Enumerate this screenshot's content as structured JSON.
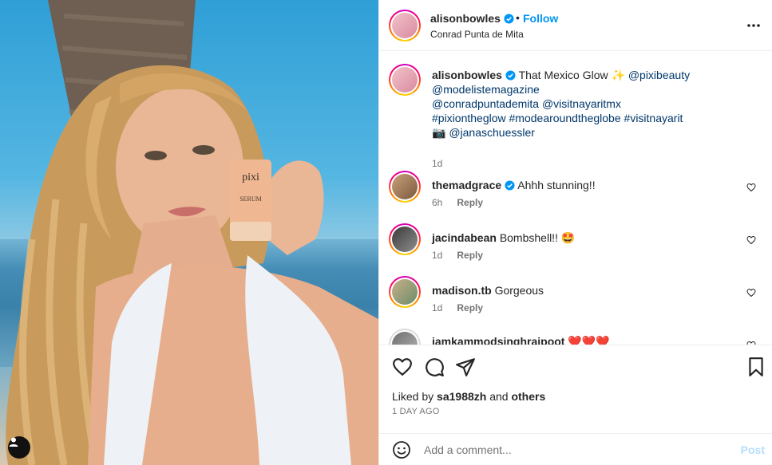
{
  "post": {
    "username": "alisonbowles",
    "follow_label": "Follow",
    "separator": "•",
    "location": "Conrad Punta de Mita",
    "photo": {
      "product_brand": "pixi",
      "product_name": "SERUM"
    }
  },
  "caption": {
    "username": "alisonbowles",
    "text": "That Mexico Glow",
    "emoji": "✨",
    "tag_pixibeauty": "@pixibeauty",
    "tag_modeliste": "@modelistemagazine",
    "tag_conrad": "@conradpuntademita",
    "tag_nayarit": "@visitnayaritmx",
    "hashtag_pixi": "#pixiontheglow",
    "hashtag_mode": "#modearoundtheglobe",
    "hashtag_nayarit": "#visitnayarit",
    "camera_emoji": "📷",
    "tag_jana": "@janaschuessler",
    "time": "1d"
  },
  "comments": [
    {
      "username": "themadgrace",
      "verified": true,
      "text": "Ahhh stunning!!",
      "time": "6h",
      "reply": "Reply"
    },
    {
      "username": "jacindabean",
      "verified": false,
      "text": "Bombshell!! 🤩",
      "time": "1d",
      "reply": "Reply"
    },
    {
      "username": "madison.tb",
      "verified": false,
      "text": "Gorgeous",
      "time": "1d",
      "reply": "Reply"
    },
    {
      "username": "iamkammodsinghrajpoot",
      "verified": false,
      "text": "❤️❤️❤️",
      "time": "",
      "reply": ""
    }
  ],
  "actions": {
    "liked_by_prefix": "Liked by",
    "liked_by_user": "sa1988zh",
    "liked_by_and": "and",
    "liked_by_others": "others",
    "post_age": "1 DAY AGO"
  },
  "composer": {
    "placeholder": "Add a comment...",
    "post_label": "Post"
  },
  "colors": {
    "accent": "#0095f6",
    "link": "#00376b",
    "muted": "#737373",
    "post_disabled": "#b2dffc"
  }
}
